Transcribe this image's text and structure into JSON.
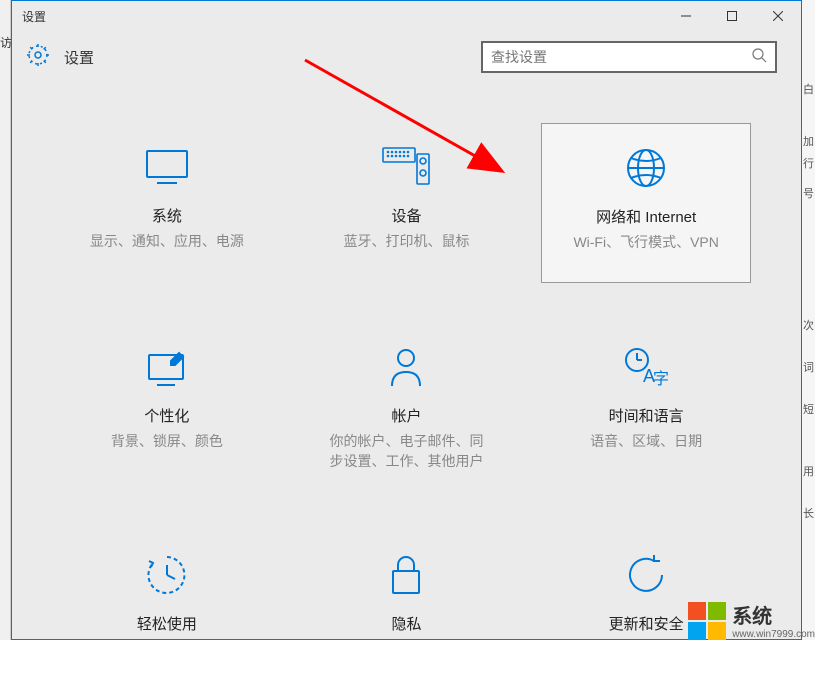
{
  "window_title": "设置",
  "header": {
    "title": "设置"
  },
  "search": {
    "placeholder": "查找设置"
  },
  "tiles": [
    {
      "key": "system",
      "title": "系统",
      "desc": "显示、通知、应用、电源"
    },
    {
      "key": "devices",
      "title": "设备",
      "desc": "蓝牙、打印机、鼠标"
    },
    {
      "key": "network",
      "title": "网络和 Internet",
      "desc": "Wi-Fi、飞行模式、VPN"
    },
    {
      "key": "personalization",
      "title": "个性化",
      "desc": "背景、锁屏、颜色"
    },
    {
      "key": "accounts",
      "title": "帐户",
      "desc": "你的帐户、电子邮件、同步设置、工作、其他用户"
    },
    {
      "key": "time",
      "title": "时间和语言",
      "desc": "语音、区域、日期"
    },
    {
      "key": "ease",
      "title": "轻松使用",
      "desc": ""
    },
    {
      "key": "privacy",
      "title": "隐私",
      "desc": ""
    },
    {
      "key": "update",
      "title": "更新和安全",
      "desc": ""
    }
  ],
  "sidebar_partial": "访",
  "right_strip": [
    "白",
    "加",
    "行",
    "号",
    "次",
    "词",
    "短",
    "用",
    "长"
  ],
  "watermark": {
    "main": "系统",
    "url": "www.win7999.com"
  }
}
